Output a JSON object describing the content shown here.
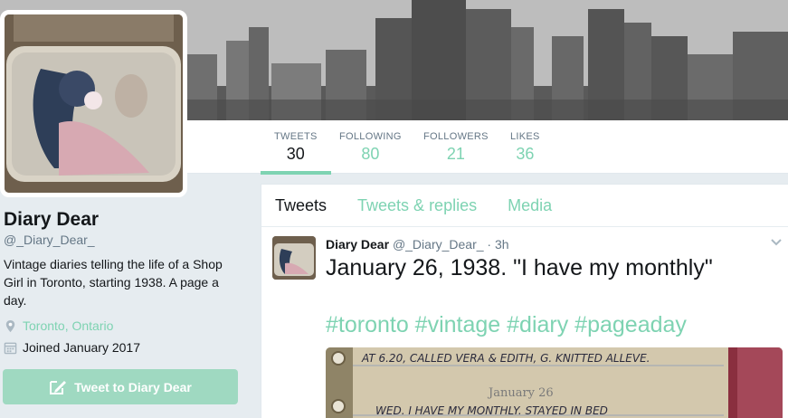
{
  "profile": {
    "name": "Diary Dear",
    "handle": "@_Diary_Dear_",
    "bio": "Vintage diaries telling the life of a Shop Girl in Toronto, starting 1938. A page a day.",
    "location": "Toronto, Ontario",
    "joined": "Joined January 2017",
    "tweet_button": "Tweet to Diary Dear"
  },
  "stats": [
    {
      "label": "TWEETS",
      "value": "30"
    },
    {
      "label": "FOLLOWING",
      "value": "80"
    },
    {
      "label": "FOLLOWERS",
      "value": "21"
    },
    {
      "label": "LIKES",
      "value": "36"
    }
  ],
  "tabs": [
    {
      "label": "Tweets"
    },
    {
      "label": "Tweets & replies"
    },
    {
      "label": "Media"
    }
  ],
  "tweet": {
    "name": "Diary Dear",
    "meta": "@_Diary_Dear_ · 3h",
    "text": "January 26, 1938. \"I have my monthly\"",
    "hashtags": "#toronto #vintage #diary #pageaday",
    "image_lines": [
      "AT 6.20, CALLED VERA & EDITH, G. KNITTED ALLEVE.",
      "January 26",
      "WED. I HAVE MY MONTHLY. STAYED IN BED"
    ]
  },
  "colors": {
    "accent": "#7ed3b2",
    "button": "#9fd9c1",
    "text": "#14171a",
    "muted": "#657786"
  },
  "icons": [
    "location-pin-icon",
    "calendar-icon",
    "compose-icon",
    "chevron-down-icon"
  ]
}
